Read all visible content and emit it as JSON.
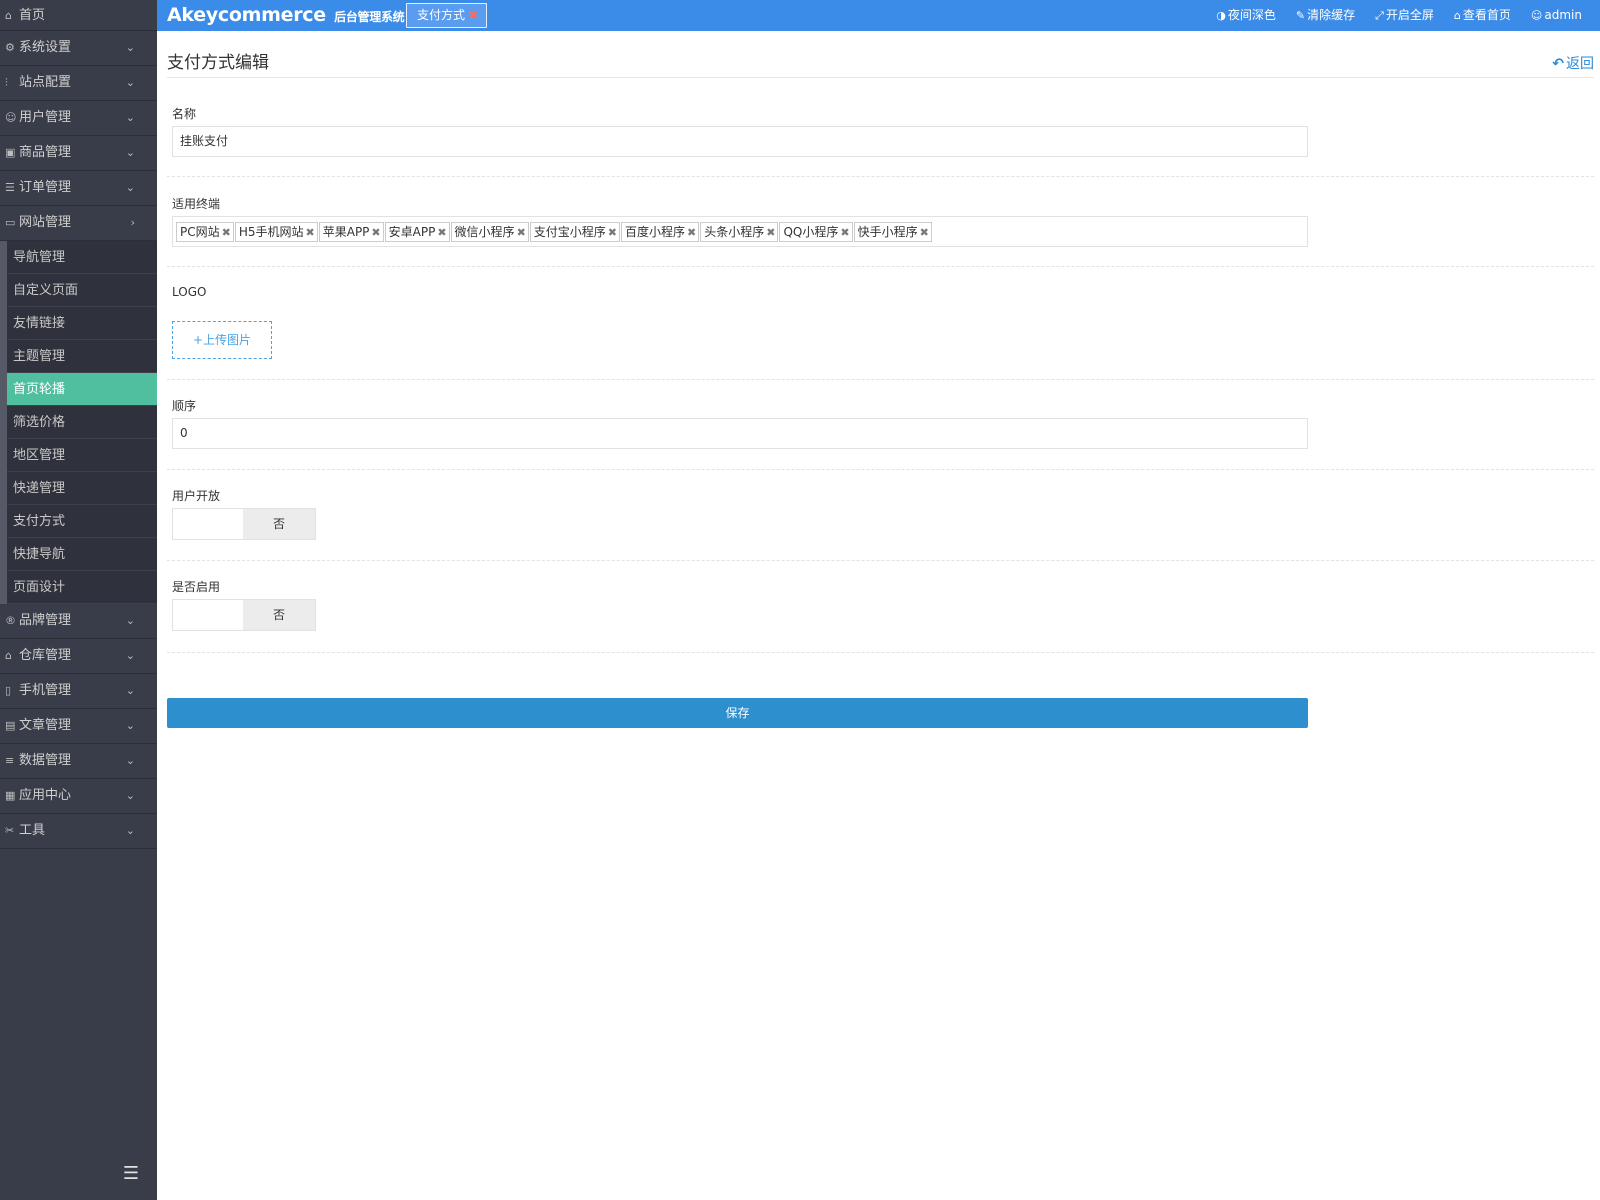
{
  "sidebar": {
    "home": {
      "icon": "home-icon",
      "label": "首页"
    },
    "groups": [
      {
        "icon": "gear-icon",
        "label": "系统设置",
        "expanded": false
      },
      {
        "icon": "sliders-icon",
        "label": "站点配置",
        "expanded": false
      },
      {
        "icon": "user-icon",
        "label": "用户管理",
        "expanded": false
      },
      {
        "icon": "bag-icon",
        "label": "商品管理",
        "expanded": false
      },
      {
        "icon": "list-icon",
        "label": "订单管理",
        "expanded": false
      },
      {
        "icon": "website-icon",
        "label": "网站管理",
        "expanded": true
      }
    ],
    "website_sub": [
      {
        "label": "导航管理",
        "active": false
      },
      {
        "label": "自定义页面",
        "active": false
      },
      {
        "label": "友情链接",
        "active": false
      },
      {
        "label": "主题管理",
        "active": false
      },
      {
        "label": "首页轮播",
        "active": true
      },
      {
        "label": "筛选价格",
        "active": false
      },
      {
        "label": "地区管理",
        "active": false
      },
      {
        "label": "快递管理",
        "active": false
      },
      {
        "label": "支付方式",
        "active": false
      },
      {
        "label": "快捷导航",
        "active": false
      },
      {
        "label": "页面设计",
        "active": false
      }
    ],
    "groups_after": [
      {
        "icon": "brand-icon",
        "label": "品牌管理"
      },
      {
        "icon": "warehouse-icon",
        "label": "仓库管理"
      },
      {
        "icon": "mobile-icon",
        "label": "手机管理"
      },
      {
        "icon": "article-icon",
        "label": "文章管理"
      },
      {
        "icon": "database-icon",
        "label": "数据管理"
      },
      {
        "icon": "apps-icon",
        "label": "应用中心"
      },
      {
        "icon": "tools-icon",
        "label": "工具"
      }
    ],
    "toggle_icon": "menu-collapse-icon"
  },
  "topbar": {
    "brand": "Akeycommerce",
    "brand_sub": "后台管理系统",
    "tab": {
      "label": "支付方式",
      "close_icon": "close-icon"
    },
    "nav": [
      {
        "icon": "contrast-icon",
        "label": "夜间深色"
      },
      {
        "icon": "brush-icon",
        "label": "清除缓存"
      },
      {
        "icon": "fullscreen-icon",
        "label": "开启全屏"
      },
      {
        "icon": "home-icon",
        "label": "查看首页"
      },
      {
        "icon": "user-icon",
        "label": "admin"
      }
    ],
    "color": "#3b8be8"
  },
  "page": {
    "title": "支付方式编辑",
    "back_label": "返回",
    "back_icon": "reply-icon"
  },
  "form": {
    "name": {
      "label": "名称",
      "value": "挂账支付"
    },
    "terminals": {
      "label": "适用终端",
      "tags": [
        "PC网站",
        "H5手机网站",
        "苹果APP",
        "安卓APP",
        "微信小程序",
        "支付宝小程序",
        "百度小程序",
        "头条小程序",
        "QQ小程序",
        "快手小程序"
      ]
    },
    "logo": {
      "label": "LOGO",
      "upload_label": "+上传图片"
    },
    "order": {
      "label": "顺序",
      "value": "0"
    },
    "user_open": {
      "label": "用户开放",
      "state": "否"
    },
    "enabled": {
      "label": "是否启用",
      "state": "否"
    },
    "save_label": "保存"
  }
}
